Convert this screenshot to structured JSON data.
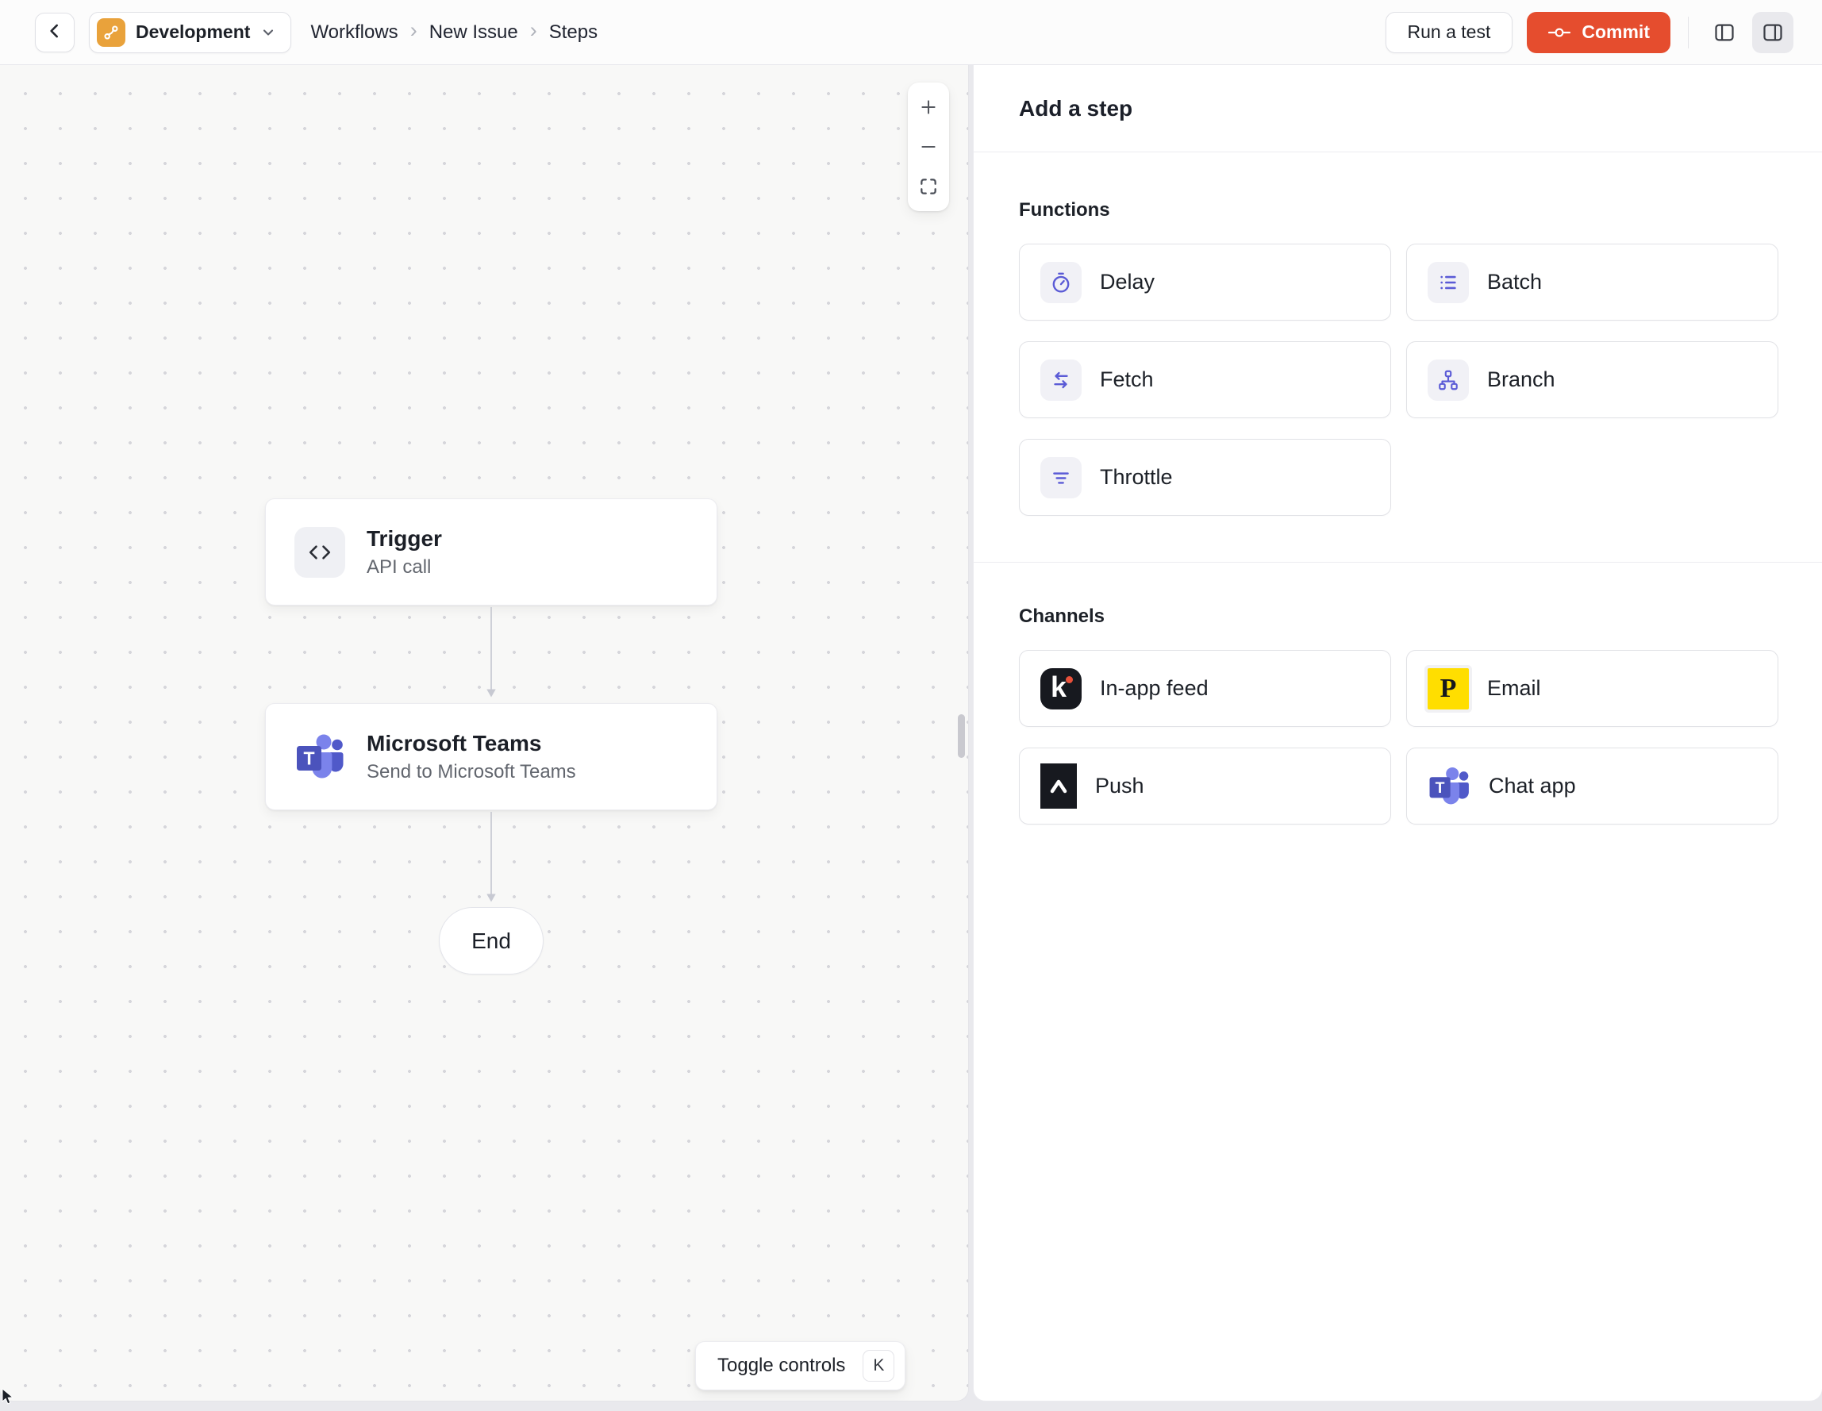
{
  "header": {
    "environment": {
      "label": "Development"
    },
    "breadcrumb": {
      "items": [
        "Workflows",
        "New Issue",
        "Steps"
      ],
      "separator": "›"
    },
    "actions": {
      "run_test": "Run a test",
      "commit": "Commit"
    }
  },
  "canvas": {
    "nodes": {
      "trigger": {
        "title": "Trigger",
        "subtitle": "API call"
      },
      "teams": {
        "title": "Microsoft Teams",
        "subtitle": "Send to Microsoft Teams"
      },
      "end": {
        "title": "End"
      }
    },
    "toggle_controls": {
      "label": "Toggle controls",
      "shortcut": "K"
    }
  },
  "panel": {
    "title": "Add a step",
    "functions": {
      "label": "Functions",
      "items": [
        {
          "label": "Delay",
          "icon": "timer-icon"
        },
        {
          "label": "Batch",
          "icon": "list-icon"
        },
        {
          "label": "Fetch",
          "icon": "swap-arrows-icon"
        },
        {
          "label": "Branch",
          "icon": "branch-tree-icon"
        },
        {
          "label": "Throttle",
          "icon": "funnel-icon"
        }
      ]
    },
    "channels": {
      "label": "Channels",
      "items": [
        {
          "label": "In-app feed",
          "icon": "knock-logo-icon"
        },
        {
          "label": "Email",
          "icon": "postmark-logo-icon"
        },
        {
          "label": "Push",
          "icon": "push-chevron-icon"
        },
        {
          "label": "Chat app",
          "icon": "microsoft-teams-icon"
        }
      ]
    }
  },
  "icons": {
    "knock_letter": "k",
    "postmark_letter": "P",
    "teams_letter": "T"
  },
  "colors": {
    "commit_button": "#E54D2E",
    "environment_badge": "#E9A23B",
    "function_icon_accent": "#5B5BD6",
    "knock_logo_bg": "#17191F",
    "postmark_logo_bg": "#FFDE00",
    "teams_logo": "#4B53BC"
  }
}
